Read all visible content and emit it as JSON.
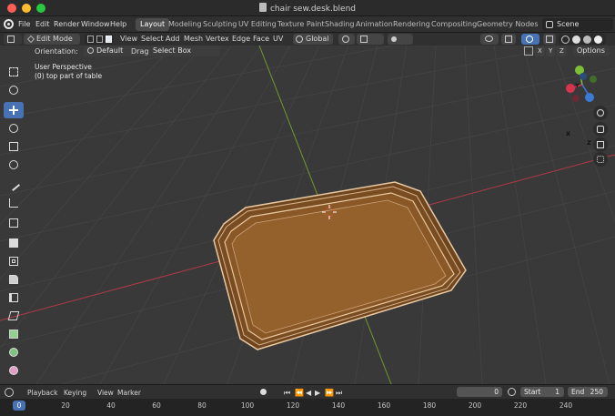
{
  "window": {
    "title": "chair sew.desk.blend"
  },
  "menu": {
    "items": [
      "File",
      "Edit",
      "Render",
      "Window",
      "Help"
    ],
    "workspaces": [
      "Layout",
      "Modeling",
      "Sculpting",
      "UV Editing",
      "Texture Paint",
      "Shading",
      "Animation",
      "Rendering",
      "Compositing",
      "Geometry Nodes"
    ],
    "active_workspace": "Layout",
    "scene": "Scene"
  },
  "viewport_header": {
    "mode": "Edit Mode",
    "menus": [
      "View",
      "Select",
      "Add",
      "Mesh",
      "Vertex",
      "Edge",
      "Face",
      "UV"
    ],
    "transform_orientation": "Global"
  },
  "tool_settings": {
    "orientation_label": "Orientation:",
    "orientation_value": "Default",
    "drag_label": "Drag:",
    "drag_value": "Select Box",
    "axes": [
      "X",
      "Y",
      "Z"
    ],
    "options_label": "Options"
  },
  "viewport": {
    "view_name": "User Perspective",
    "object_info": "(0) top part of table",
    "gizmo_axes": {
      "x": "X",
      "y": "Y",
      "z": "Z"
    },
    "colors": {
      "x_axis": "#d9344f",
      "y_axis": "#7dbf36",
      "z_axis": "#3a7bd5",
      "object_face": "#8a5726",
      "object_edge": "#e8c9a0"
    }
  },
  "tools": [
    "select-box",
    "cursor",
    "move",
    "rotate",
    "scale",
    "transform",
    "annotate",
    "measure",
    "add-cube",
    "extrude",
    "inset",
    "bevel",
    "loop-cut",
    "knife",
    "poly-build",
    "spin",
    "smooth",
    "shear"
  ],
  "timeline": {
    "menus": [
      "Playback",
      "Keying",
      "View",
      "Marker"
    ],
    "current_frame": "0",
    "start_label": "Start",
    "start": "1",
    "end_label": "End",
    "end": "250",
    "ruler_ticks": [
      "0",
      "20",
      "40",
      "60",
      "80",
      "100",
      "120",
      "140",
      "160",
      "180",
      "200",
      "220",
      "240"
    ]
  }
}
